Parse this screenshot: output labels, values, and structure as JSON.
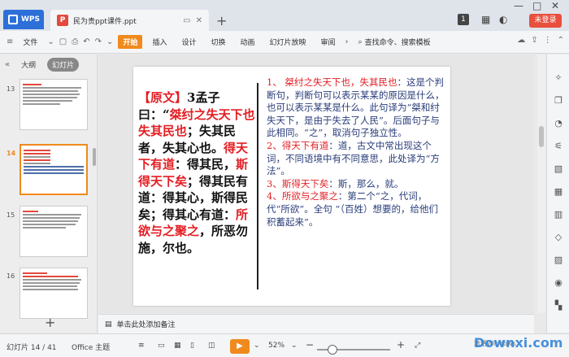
{
  "titlebar": {
    "app_tab": "WPS",
    "doc_title": "民为贵ppt课件.ppt",
    "new_tab": "+",
    "badge": "1",
    "login": "未登录",
    "min": "—",
    "max": "□",
    "close": "✕"
  },
  "menubar": {
    "file": "文件",
    "start": "开始",
    "items": [
      "插入",
      "设计",
      "切换",
      "动画",
      "幻灯片放映",
      "审阅"
    ],
    "search": "查找命令、搜索模板"
  },
  "leftpanel": {
    "tab_outline": "大纲",
    "tab_slides": "幻灯片",
    "slide_numbers": [
      "13",
      "14",
      "15",
      "16"
    ],
    "add": "+"
  },
  "slide": {
    "left": {
      "label": "【原文】",
      "num": "3",
      "intro": "孟子曰：",
      "quote_open": "“",
      "p1": "桀纣之失天下也失其民也",
      "p2": "；失其民者，失其心也。",
      "p3": "得天下有道",
      "p4": "：得其民，",
      "p5": "斯得天下矣",
      "p6": "；得其民有道：得其心，斯得民矣；得其心有道：",
      "p7": "所欲与之聚之",
      "p8": "，所恶勿施，尔也。"
    },
    "right": {
      "h1": "1、 桀纣之失天下也，失其民也",
      "t1": "：这是个判断句，判断句可以表示某某的原因是什么，也可以表示某某是什么。此句译为“桀和纣失天下，是由于失去了人民”。后面句子与此相同。“之”，取消句子独立性。",
      "h2": "2、得天下有道",
      "t2": "：道，古文中常出现这个词，不同语境中有不同意思，此处译为“方法”。",
      "h3": "3、斯得天下矣",
      "t3": "：斯，那么，就。",
      "h4": "4、所欲与之聚之",
      "t4": "：第二个“之，代词，代“所欲”。全句 “（百姓）想要的，给他们积蓄起来”。"
    }
  },
  "notes": {
    "placeholder": "单击此处添加备注"
  },
  "statusbar": {
    "slide_info": "幻灯片 14 / 41",
    "theme": "Office 主题",
    "zoom": "52%",
    "zoom_minus": "−",
    "zoom_plus": "+",
    "activate": "激活Windows"
  },
  "watermark": {
    "text": "Downxi.com"
  }
}
